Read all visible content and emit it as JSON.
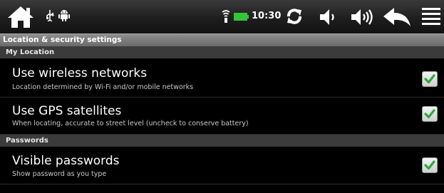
{
  "status_bar": {
    "time": "10:30",
    "icons": [
      "home-icon",
      "usb-icon",
      "android-debug-icon",
      "wifi-icon",
      "battery-icon",
      "refresh-icon",
      "volume-down-icon",
      "volume-up-icon",
      "back-icon",
      "menu-icon"
    ],
    "battery_color": "#35c43a"
  },
  "title_bar": {
    "title": "Location & security settings"
  },
  "sections": [
    {
      "header": "My Location",
      "items": [
        {
          "title": "Use wireless networks",
          "summary": "Location determined by Wi-Fi and/or mobile networks",
          "checked": true
        },
        {
          "title": "Use GPS satellites",
          "summary": "When locating, accurate to street level (uncheck to conserve battery)",
          "checked": true
        }
      ]
    },
    {
      "header": "Passwords",
      "items": [
        {
          "title": "Visible passwords",
          "summary": "Show password as you type",
          "checked": true
        }
      ]
    }
  ],
  "colors": {
    "check_green": "#2fa93c",
    "section_header_bg": "#3b3b3b",
    "title_bar_bg": "#7a7a7a"
  }
}
